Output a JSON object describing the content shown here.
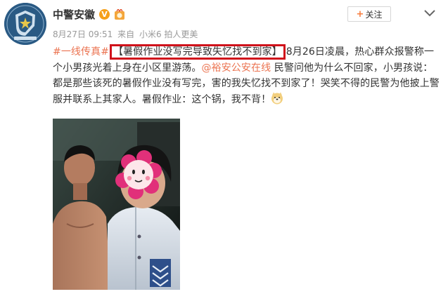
{
  "account": {
    "name": "中警安徽",
    "avatar_icon": "police-emblem-icon",
    "verified_icon": "verified-v-icon",
    "medal_icon": "medal-icon"
  },
  "meta": {
    "date": "8月27日 09:51",
    "source_prefix": "来自",
    "source": "小米6 拍人更美"
  },
  "actions": {
    "follow_label": "关注",
    "more_icon": "chevron-down-icon"
  },
  "post": {
    "hashtag": "#一线传真#",
    "headline": "【暑假作业没写完导致失忆找不到家】",
    "text1": "8月26日凌晨，热心群众报警称一个小男孩光着上身在小区里游荡。",
    "mention": "@裕安公安在线",
    "text2": " 民警问他为什么不回家，小男孩说：都是那些该死的暑假作业没有写完，害的我失忆找不到家了！哭笑不得的民警为他披上警服并联系上其家人。暑假作业：这个锅，我不背！",
    "emoji_icon": "doge-emoji-icon"
  },
  "photo": {
    "icon": "post-photo",
    "sticker_icon": "flower-sticker-icon"
  },
  "colors": {
    "link": "#eb7350",
    "highlight_border": "#d0121b",
    "text": "#333333",
    "meta": "#999999"
  }
}
